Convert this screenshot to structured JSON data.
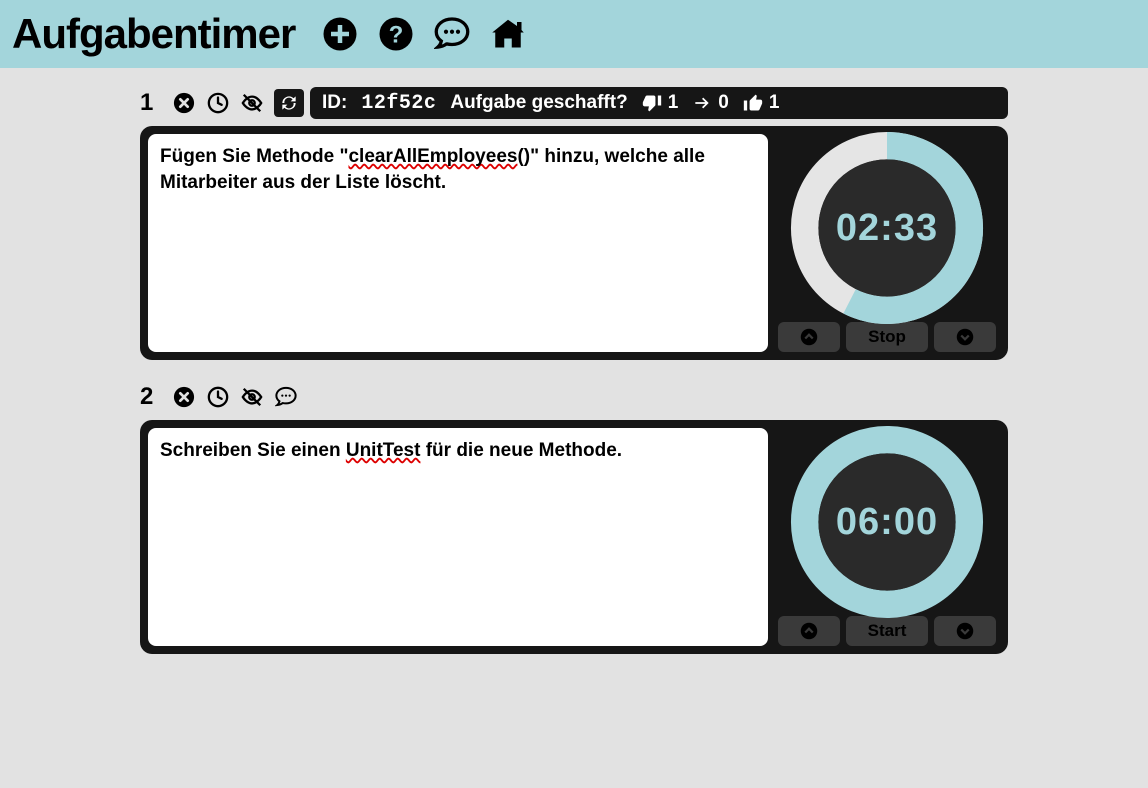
{
  "header": {
    "title": "Aufgabentimer"
  },
  "tasks": [
    {
      "number": "1",
      "sync_visible": true,
      "pill": {
        "id_label": "ID:",
        "id_value": "12f52c",
        "question": "Aufgabe geschafft?",
        "thumbs_down": "1",
        "skip": "0",
        "thumbs_up": "1"
      },
      "text_plain": "Fügen Sie Methode \"clearAllEmployees()\" hinzu, welche alle Mitarbeiter aus der Liste löscht.",
      "timer": {
        "time": "02:33",
        "progress": 0.575,
        "button_label": "Stop"
      }
    },
    {
      "number": "2",
      "sync_visible": false,
      "text_plain": "Schreiben Sie einen UnitTest für die neue Methode.",
      "timer": {
        "time": "06:00",
        "progress": 1.0,
        "button_label": "Start"
      }
    }
  ]
}
